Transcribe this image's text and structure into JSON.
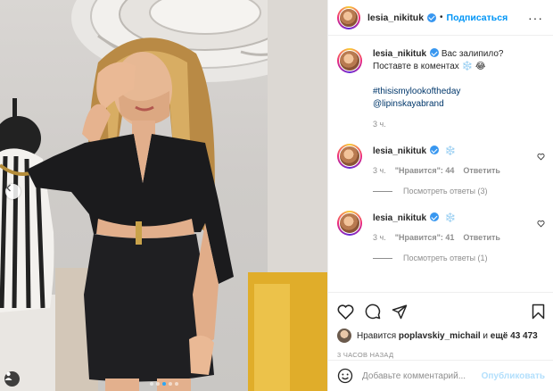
{
  "post": {
    "username": "lesia_nikituk",
    "follow_label": "Подписаться",
    "more_label": "···"
  },
  "caption": {
    "line1": "Вас залипило?",
    "line2": "Поставте в коментах ❄️ 😂",
    "hashtag": "#thisismylookoftheday",
    "mention": "@lipinskayabrand",
    "time": "3 ч."
  },
  "comments": [
    {
      "username": "lesia_nikituk",
      "text": "❄️",
      "time": "3 ч.",
      "likes": "\"Нравится\": 44",
      "reply_label": "Ответить",
      "view_replies": "Посмотреть ответы (3)"
    },
    {
      "username": "lesia_nikituk",
      "text": "❄️",
      "time": "3 ч.",
      "likes": "\"Нравится\": 41",
      "reply_label": "Ответить",
      "view_replies": "Посмотреть ответы (1)"
    }
  ],
  "likes": {
    "prefix": "Нравится",
    "user": "poplavskiy_michail",
    "and": "и",
    "more": "ещё 43 473"
  },
  "timestamp": "3 ЧАСОВ НАЗАД",
  "composer": {
    "placeholder": "Добавьте комментарий...",
    "publish_label": "Опубликовать",
    "emoji_icon": "smile-icon"
  },
  "colors": {
    "link_blue": "#0095f6",
    "hashtag": "#00376b",
    "muted": "#8e8e8e",
    "verified": "#3897f0",
    "carousel_active_dot": "#2aa6f5"
  },
  "carousel": {
    "total": 5,
    "active": 3
  }
}
